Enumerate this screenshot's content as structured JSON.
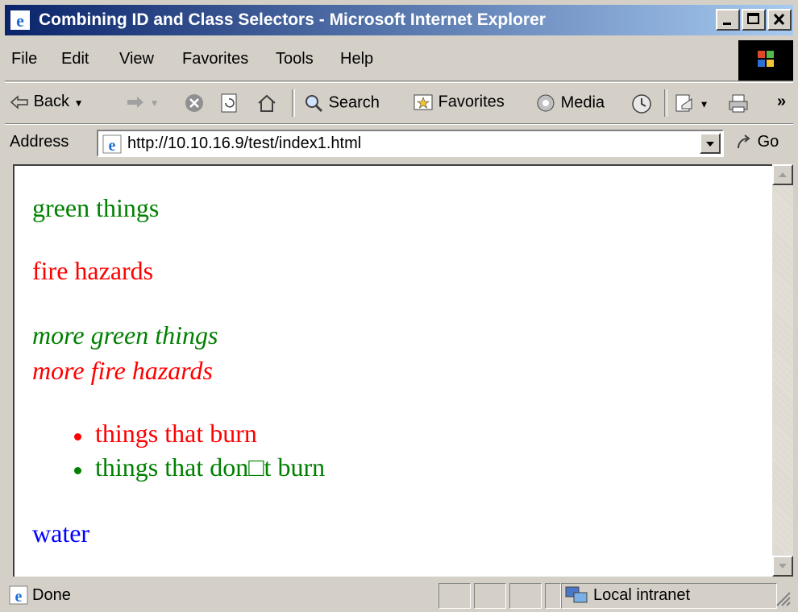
{
  "window": {
    "title": "Combining ID and Class Selectors - Microsoft Internet Explorer"
  },
  "menu": [
    "File",
    "Edit",
    "View",
    "Favorites",
    "Tools",
    "Help"
  ],
  "toolbar": {
    "back": "Back",
    "search": "Search",
    "favorites": "Favorites",
    "media": "Media",
    "more": "»"
  },
  "address": {
    "label": "Address",
    "url": "http://10.10.16.9/test/index1.html",
    "go": "Go"
  },
  "content": {
    "line1": "green things",
    "line2": "fire hazards",
    "line3": "more green things",
    "line4": "more fire hazards",
    "list": [
      "things that burn",
      "things that don□t burn"
    ],
    "line5": "water"
  },
  "colors": {
    "green": "#008000",
    "red": "#ff0000",
    "blue": "#0000ff",
    "titlebar": "#0a246a"
  },
  "status": {
    "text": "Done",
    "zone": "Local intranet"
  }
}
